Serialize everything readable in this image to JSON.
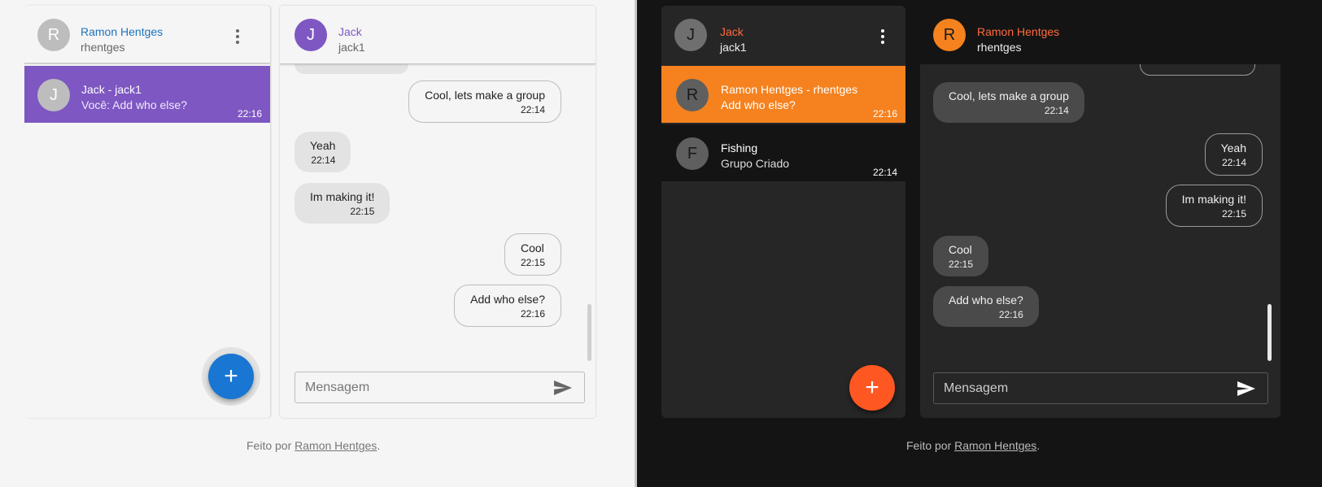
{
  "colors": {
    "light_accent": "#7e57c2",
    "light_fab": "#1976d2",
    "light_header_name": "#1e73be",
    "dark_accent": "#f5821f",
    "dark_fab": "#ff5722",
    "dark_header_name": "#ff6b3d"
  },
  "light": {
    "sidebar": {
      "user_initial": "R",
      "user_name": "Ramon Hentges",
      "user_handle": "rhentges",
      "conversations": [
        {
          "initial": "J",
          "name": "Jack - jack1",
          "last_message": "Você: Add who else?",
          "time": "22:16"
        }
      ],
      "fab_icon": "plus-icon",
      "fab_label": "+"
    },
    "chat": {
      "contact_initial": "J",
      "contact_name": "Jack",
      "contact_handle": "jack1",
      "messages": [
        {
          "text": "Cool, lets make a group",
          "time": "22:14",
          "direction": "out"
        },
        {
          "text": "Yeah",
          "time": "22:14",
          "direction": "in"
        },
        {
          "text": "Im making it!",
          "time": "22:15",
          "direction": "in"
        },
        {
          "text": "Cool",
          "time": "22:15",
          "direction": "out"
        },
        {
          "text": "Add who else?",
          "time": "22:16",
          "direction": "out"
        }
      ],
      "input_placeholder": "Mensagem"
    },
    "footer": {
      "prefix": "Feito por ",
      "link": "Ramon Hentges",
      "suffix": "."
    }
  },
  "dark": {
    "sidebar": {
      "user_initial": "J",
      "user_name": "Jack",
      "user_handle": "jack1",
      "conversations": [
        {
          "initial": "R",
          "name": "Ramon Hentges - rhentges",
          "last_message": "Add who else?",
          "time": "22:16",
          "active": true
        },
        {
          "initial": "F",
          "name": "Fishing",
          "last_message": "Grupo Criado",
          "time": "22:14",
          "active": false
        }
      ],
      "fab_icon": "plus-icon",
      "fab_label": "+"
    },
    "chat": {
      "contact_initial": "R",
      "contact_name": "Ramon Hentges",
      "contact_handle": "rhentges",
      "messages": [
        {
          "text": "Cool, lets make a group",
          "time": "22:14",
          "direction": "in"
        },
        {
          "text": "Yeah",
          "time": "22:14",
          "direction": "out"
        },
        {
          "text": "Im making it!",
          "time": "22:15",
          "direction": "out"
        },
        {
          "text": "Cool",
          "time": "22:15",
          "direction": "in"
        },
        {
          "text": "Add who else?",
          "time": "22:16",
          "direction": "in"
        }
      ],
      "input_placeholder": "Mensagem"
    },
    "footer": {
      "prefix": "Feito por ",
      "link": "Ramon Hentges",
      "suffix": "."
    }
  }
}
